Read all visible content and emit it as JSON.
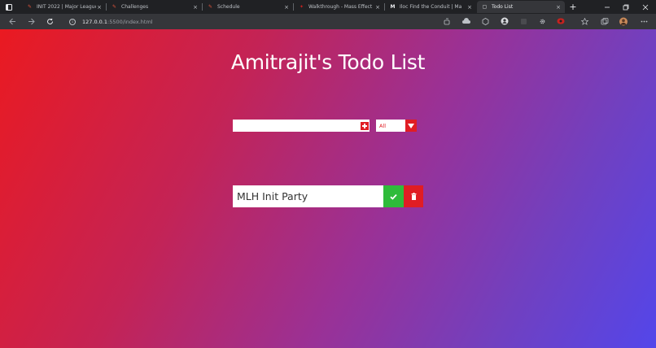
{
  "browser": {
    "tabs": [
      {
        "title": "INIT 2022 | Major League H",
        "favicon": "pencil-icon",
        "active": false
      },
      {
        "title": "Challenges",
        "favicon": "pencil-icon",
        "active": false
      },
      {
        "title": "Schedule",
        "favicon": "pencil-icon",
        "active": false
      },
      {
        "title": "Walkthrough - Mass Effect",
        "favicon": "game-icon",
        "active": false
      },
      {
        "title": "Iloc Find the Conduit | Ma",
        "favicon": "m-icon",
        "active": false
      },
      {
        "title": "Todo List",
        "favicon": "page-icon",
        "active": true
      }
    ],
    "tab_close_glyph": "×",
    "new_tab_glyph": "+",
    "url_host": "127.0.0.1",
    "url_rest": ":5500/index.html"
  },
  "app": {
    "title": "Amitrajit's Todo List",
    "input": {
      "value": "",
      "placeholder": ""
    },
    "filter": {
      "selected": "All"
    },
    "todos": [
      {
        "text": "MLH Init Party"
      }
    ]
  },
  "colors": {
    "accent_red": "#e01d24",
    "complete_green": "#2fbb3b",
    "gradient_start": "#ea1a21",
    "gradient_end": "#5346ea"
  }
}
